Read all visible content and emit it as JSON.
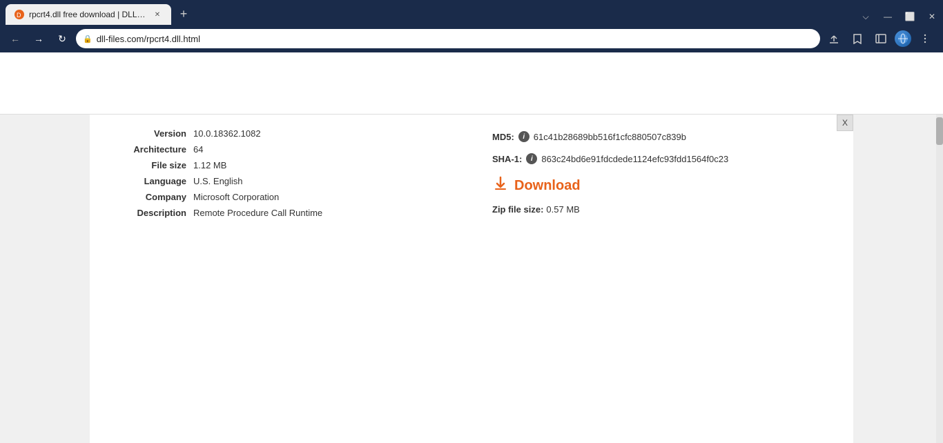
{
  "browser": {
    "tab": {
      "title": "rpcrt4.dll free download | DLL-fi...",
      "favicon": "🔴"
    },
    "address": "dll-files.com/rpcrt4.dll.html",
    "close_btn": "✕",
    "minimize_btn": "—",
    "maximize_btn": "⬜",
    "new_tab_btn": "+",
    "lock_icon": "🔒"
  },
  "close_x": "X",
  "file_info": {
    "version_label": "Version",
    "version_value": "10.0.18362.1082",
    "architecture_label": "Architecture",
    "architecture_value": "64",
    "filesize_label": "File size",
    "filesize_value": "1.12 MB",
    "language_label": "Language",
    "language_value": "U.S. English",
    "company_label": "Company",
    "company_value": "Microsoft Corporation",
    "description_label": "Description",
    "description_value": "Remote Procedure Call Runtime"
  },
  "hash_info": {
    "md5_label": "MD5:",
    "md5_value": "61c41b28689bb516f1cfc880507c839b",
    "sha1_label": "SHA-1:",
    "sha1_value": "863c24bd6e91fdcdede1124efc93fdd1564f0c23"
  },
  "download": {
    "label": "Download",
    "icon": "⬇",
    "zip_label": "Zip file size:",
    "zip_value": "0.57 MB"
  }
}
